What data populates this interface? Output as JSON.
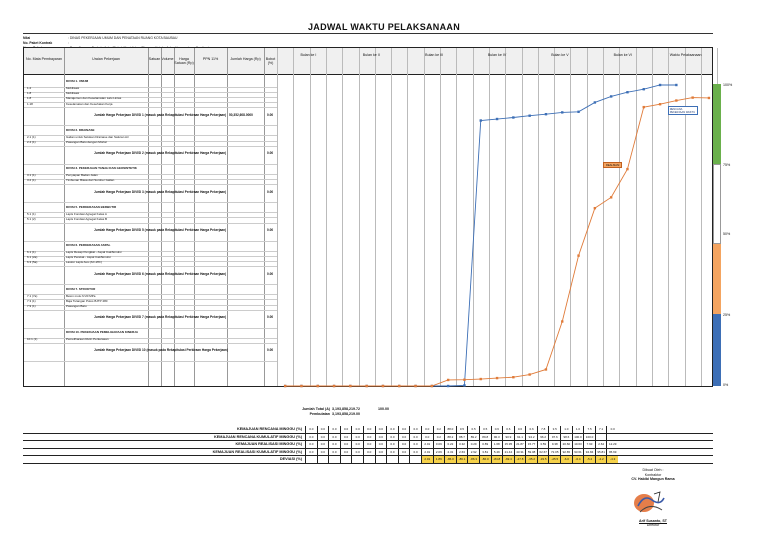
{
  "title": "JADWAL WAKTU PELAKSANAAN",
  "meta": [
    {
      "k": "Nilai",
      "v": ": DINAS PEKERJAAN UMUM DAN PENATAAN RUANG KOTA BAUBAU"
    },
    {
      "k": "No. Paket Kontrak",
      "v": ":"
    },
    {
      "k": "Nama Paket",
      "v": ": Pemeliharaan Berkala Jalan/Rehabilitasi Jalan (Binuang Kota) - Jalan Kecamatan - Cantiwai"
    },
    {
      "k": "Prop / Kab / Kodya",
      "v": ": Maluku Utara / Kota Ternate"
    }
  ],
  "header": {
    "no": "No. Mata Pembayaran",
    "uraian": "Uraian Pekerjaan",
    "satuan": "Satuan",
    "volume": "Volume",
    "harga": "Harga Satuan (Rp)",
    "ppn": "PPN 11%",
    "jumlah": "Jumlah Harga (Rp)",
    "bobot": "Bobot (%)",
    "months": [
      "Bulan ke I",
      "Bulan ke II",
      "Bulan ke III",
      "Bulan ke IV",
      "Bulan ke V",
      "Bulan ke VI",
      "Waktu Pelaksanaan"
    ]
  },
  "rows": [
    {
      "type": "sec",
      "uraian": "DIVISI 1. UMUM"
    },
    {
      "no": "1.2",
      "uraian": "Mobilisasi"
    },
    {
      "no": "1.8",
      "uraian": "Mobilisasi"
    },
    {
      "no": "1.8",
      "uraian": "Manajemen dan Keselamatan Lalu Lintas"
    },
    {
      "no": "1.18",
      "uraian": "Keselamatan dan Kesehatan Kerja"
    },
    {
      "type": "jml",
      "uraian": "Jumlah Harga Pekerjaan DIVISI 1 (masuk pada Rekapitulasi Perkiraan Harga Pekerjaan)",
      "jumlah": "50,352,608.0000",
      "bobot": "0.00"
    },
    {
      "type": "sec",
      "uraian": "DIVISI 2. DRAINASE"
    },
    {
      "no": "2.1 (1)",
      "uraian": "Galian untuk Selokan Drainase dan Saluran Air"
    },
    {
      "no": "2.4 (1)",
      "uraian": "Pasangan Batu dengan Mortar"
    },
    {
      "type": "jml",
      "uraian": "Jumlah Harga Pekerjaan DIVISI 2 (masuk pada Rekapitulasi Perkiraan Harga Pekerjaan)",
      "jumlah": "",
      "bobot": "0.00"
    },
    {
      "type": "sec",
      "uraian": "DIVISI 3. PEKERJAAN TANAH DAN GEOSINTETIK"
    },
    {
      "no": "3.1 (1)",
      "uraian": "Penyiapan Badan Jalan"
    },
    {
      "no": "3.2 (1)",
      "uraian": "Timbunan Biasa dari Sumber Galian"
    },
    {
      "type": "jml",
      "uraian": "Jumlah Harga Pekerjaan DIVISI 3 (masuk pada Rekapitulasi Perkiraan Harga Pekerjaan)",
      "jumlah": "",
      "bobot": "0.00"
    },
    {
      "type": "sec",
      "uraian": "DIVISI 5. PERKERASAN BERBUTIR"
    },
    {
      "no": "5.1 (1)",
      "uraian": "Lapis Fondasi Agregat Kelas A"
    },
    {
      "no": "5.1 (2)",
      "uraian": "Lapis Fondasi Agregat Kelas B"
    },
    {
      "type": "jml",
      "uraian": "Jumlah Harga Pekerjaan DIVISI 5 (masuk pada Rekapitulasi Perkiraan Harga Pekerjaan)",
      "jumlah": "",
      "bobot": "0.00"
    },
    {
      "type": "sec",
      "uraian": "DIVISI 6. PERKERASAN ASPAL"
    },
    {
      "no": "6.1 (1)",
      "uraian": "Lapis Resap Pengikat - Aspal Cair/Emulsi"
    },
    {
      "no": "6.1 (2a)",
      "uraian": "Lapis Perekat - Aspal Cair/Emulsi"
    },
    {
      "no": "6.3 (5a)",
      "uraian": "Laston Lapis Aus (AC-WC)"
    },
    {
      "type": "jml",
      "uraian": "Jumlah Harga Pekerjaan DIVISI 6 (masuk pada Rekapitulasi Perkiraan Harga Pekerjaan)",
      "jumlah": "",
      "bobot": "0.00"
    },
    {
      "type": "sec",
      "uraian": "DIVISI 7. STRUKTUR"
    },
    {
      "no": "7.1 (7a)",
      "uraian": "Beton mutu fc'20 MPa"
    },
    {
      "no": "7.3 (1)",
      "uraian": "Baja Tulangan Polos BJTP 280"
    },
    {
      "no": "7.9 (1)",
      "uraian": "Pasangan Batu"
    },
    {
      "type": "jml",
      "uraian": "Jumlah Harga Pekerjaan DIVISI 7 (masuk pada Rekapitulasi Perkiraan Harga Pekerjaan)",
      "jumlah": "",
      "bobot": "0.00"
    },
    {
      "type": "sec",
      "uraian": "DIVISI 10. PEKERJAAN PEMELIHARAAN KINERJA"
    },
    {
      "no": "10.1 (1)",
      "uraian": "Pemeliharaan Rutin Perkerasan"
    },
    {
      "type": "jml",
      "uraian": "Jumlah Harga Pekerjaan DIVISI 10 (masuk pada Rekapitulasi Perkiraan Harga Pekerjaan)",
      "jumlah": "",
      "bobot": "0.00"
    }
  ],
  "totals": [
    {
      "label": "Jumlah Total (A)",
      "value": "3,193,858,219.72",
      "bobot": "100.00"
    },
    {
      "label": "Pembulatan",
      "value": "3,193,858,219.00"
    }
  ],
  "summary": [
    {
      "label": "KEMAJUAN RENCANA MINGGU (%)",
      "values": [
        "0.0",
        "0.0",
        "0.0",
        "0.0",
        "0.0",
        "0.0",
        "0.0",
        "0.0",
        "0.0",
        "0.0",
        "0.0",
        "0.2",
        "88.0",
        "0.5",
        "0.5",
        "0.5",
        "0.6",
        "0.6",
        "0.6",
        "0.6",
        "7.8",
        "3.5",
        "1.0",
        "1.0",
        "7.5",
        "7.1",
        "0.0"
      ]
    },
    {
      "label": "KEMAJUAN RENCANA KUMULATIF MINGGU (%)",
      "values": [
        "0.0",
        "0.0",
        "0.0",
        "0.0",
        "0.0",
        "0.0",
        "0.0",
        "0.0",
        "0.0",
        "0.0",
        "0.0",
        "0.2",
        "88.2",
        "88.7",
        "89.2",
        "89.8",
        "90.3",
        "90.9",
        "91.1",
        "94.2",
        "96.2",
        "97.6",
        "98.6",
        "100.0",
        "100.0",
        "",
        ""
      ]
    },
    {
      "label": "KEMAJUAN REALISASI MINGGU (%)",
      "values": [
        "0.0",
        "0.0",
        "0.0",
        "0.0",
        "0.0",
        "0.0",
        "0.0",
        "0.0",
        "0.0",
        "0.0",
        "2.01",
        "0.09",
        "0.22",
        "0.32",
        "0.29",
        "0.89",
        "1.68",
        "15.95",
        "21.87",
        "15.77",
        "3.59",
        "9.38",
        "20.60",
        "10.63",
        "7.93",
        "2.64",
        "12.29"
      ]
    },
    {
      "label": "KEMAJUAN REALISASI KUMULATIF MINGGU (%)",
      "values": [
        "0.0",
        "0.0",
        "0.0",
        "0.0",
        "0.0",
        "0.0",
        "0.0",
        "0.0",
        "0.0",
        "0.0",
        "2.01",
        "2.09",
        "2.31",
        "2.63",
        "2.92",
        "3.81",
        "5.49",
        "21.44",
        "43.31",
        "59.08",
        "62.67",
        "72.05",
        "92.65",
        "93.61",
        "94.84",
        "95.81",
        "95.69"
      ]
    },
    {
      "label": "DEVIASI (%)",
      "values": [
        "",
        "",
        "",
        "",
        "",
        "",
        "",
        "",
        "",
        "",
        "2.01",
        "1.89",
        "-86.0",
        "-86.1",
        "-86.3",
        "-86.0",
        "-84.8",
        "-69.4",
        "-47.8",
        "-35.2",
        "-33.5",
        "-25.5",
        "-6.0",
        "-6.4",
        "-5.2",
        "-4.2",
        "-4.3"
      ],
      "hl": true
    }
  ],
  "pct_labels": [
    "100%",
    "75%",
    "50%",
    "25%",
    "0%"
  ],
  "notes": {
    "blue": "RENCANA PEKERJAAN WAKTU",
    "orange": "REALISASI"
  },
  "signer": {
    "role1": "Dibuat Oleh :",
    "role2": "Kontraktor",
    "company": "CV. Habibi Mangun Rama",
    "name": "Arif Susanto, ST",
    "title": "Direktur"
  }
}
